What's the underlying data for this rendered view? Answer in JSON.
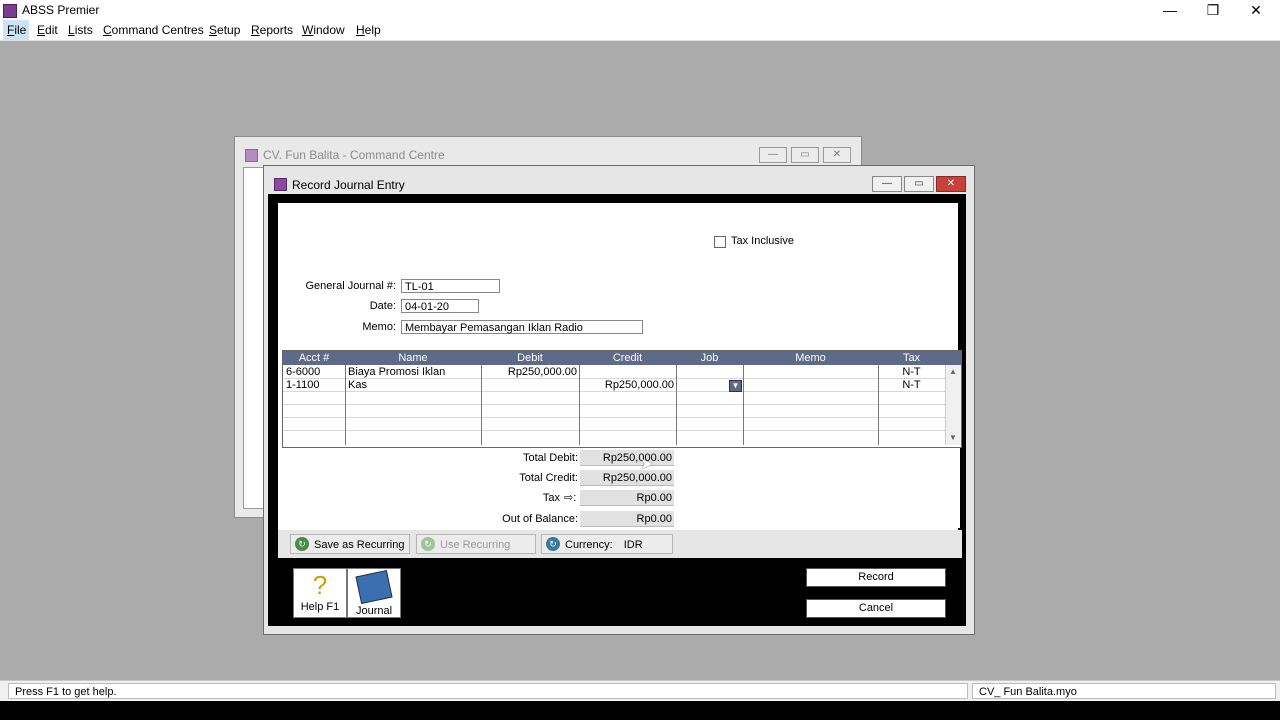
{
  "app": {
    "title": "ABSS Premier",
    "controls": {
      "minimize": "—",
      "restore": "❐",
      "close": "✕"
    }
  },
  "menu": [
    "File",
    "Edit",
    "Lists",
    "Command Centres",
    "Setup",
    "Reports",
    "Window",
    "Help"
  ],
  "command_centre": {
    "title": "CV. Fun Balita - Command Centre"
  },
  "dialog": {
    "title": "Record Journal Entry",
    "tax_inclusive_label": "Tax Inclusive",
    "general_journal_label": "General Journal #:",
    "general_journal_value": "TL-01",
    "date_label": "Date:",
    "date_value": "04-01-20",
    "memo_label": "Memo:",
    "memo_value": "Membayar Pemasangan Iklan Radio",
    "grid": {
      "headers": [
        "Acct #",
        "Name",
        "Debit",
        "Credit",
        "Job",
        "Memo",
        "Tax"
      ],
      "rows": [
        {
          "acct": "6-6000",
          "name": "Biaya Promosi Iklan",
          "debit": "Rp250,000.00",
          "credit": "",
          "job": "",
          "memo": "",
          "tax": "N-T"
        },
        {
          "acct": "1-1100",
          "name": "Kas",
          "debit": "",
          "credit": "Rp250,000.00",
          "job": "",
          "memo": "",
          "tax": "N-T"
        }
      ]
    },
    "totals": {
      "total_debit_label": "Total Debit:",
      "total_debit": "Rp250,000.00",
      "total_credit_label": "Total Credit:",
      "total_credit": "Rp250,000.00",
      "tax_label": "Tax",
      "tax": "Rp0.00",
      "out_of_balance_label": "Out of Balance:",
      "out_of_balance": "Rp0.00"
    },
    "buttons": {
      "save_recurring": "Save as Recurring",
      "use_recurring": "Use Recurring",
      "currency_label": "Currency:",
      "currency_value": "IDR",
      "help": "Help F1",
      "journal": "Journal",
      "record": "Record",
      "cancel": "Cancel"
    }
  },
  "status": {
    "left": "Press F1 to get help.",
    "right": "CV_ Fun Balita.myo"
  }
}
